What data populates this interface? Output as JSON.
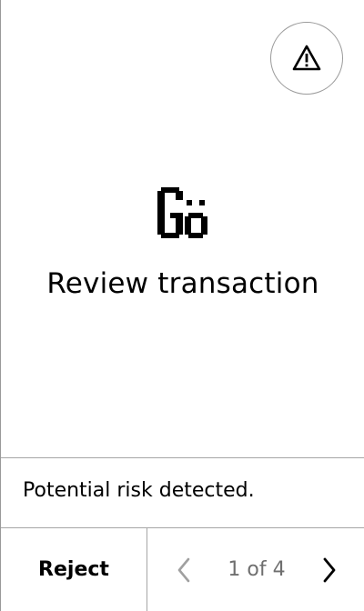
{
  "header": {
    "warning_icon": "warning-triangle-icon"
  },
  "main": {
    "logo_icon": "app-logo-icon",
    "title": "Review transaction"
  },
  "notice": {
    "text": "Potential risk detected."
  },
  "footer": {
    "reject_label": "Reject",
    "prev_icon": "chevron-left-icon",
    "next_icon": "chevron-right-icon",
    "page_indicator": "1 of 4",
    "prev_enabled": false,
    "next_enabled": true
  },
  "colors": {
    "background": "#ffffff",
    "text": "#000000",
    "muted_text": "#6f6f6f",
    "divider": "#a6a6a6",
    "disabled_chevron": "#a0a0a0"
  }
}
